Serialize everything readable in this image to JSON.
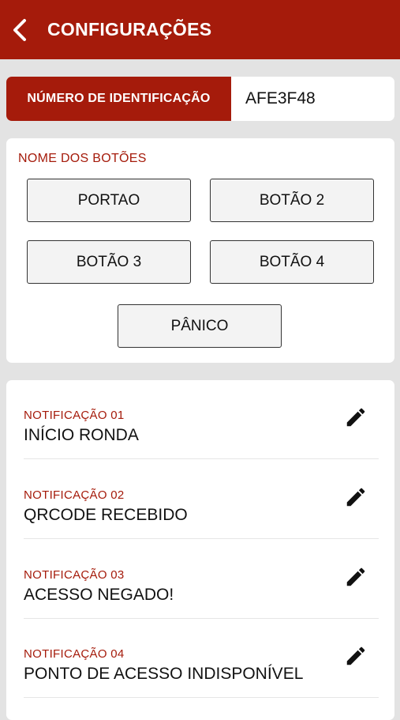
{
  "header": {
    "title": "CONFIGURAÇÕES",
    "back_icon": "chevron-left-icon",
    "color": "#a51b0b"
  },
  "identification": {
    "label": "NÚMERO DE IDENTIFICAÇÃO",
    "value": "AFE3F48"
  },
  "buttons_section": {
    "label": "NOME DOS BOTÕES",
    "buttons": [
      "PORTAO",
      "BOTÃO 2",
      "BOTÃO 3",
      "BOTÃO 4",
      "PÂNICO"
    ]
  },
  "notifications": [
    {
      "label": "NOTIFICAÇÃO 01",
      "text": "INÍCIO RONDA",
      "icon": "pencil-icon"
    },
    {
      "label": "NOTIFICAÇÃO 02",
      "text": "QRCODE RECEBIDO",
      "icon": "pencil-icon"
    },
    {
      "label": "NOTIFICAÇÃO 03",
      "text": "ACESSO NEGADO!",
      "icon": "pencil-icon"
    },
    {
      "label": "NOTIFICAÇÃO 04",
      "text": "PONTO DE ACESSO INDISPONÍVEL",
      "icon": "pencil-icon"
    }
  ]
}
